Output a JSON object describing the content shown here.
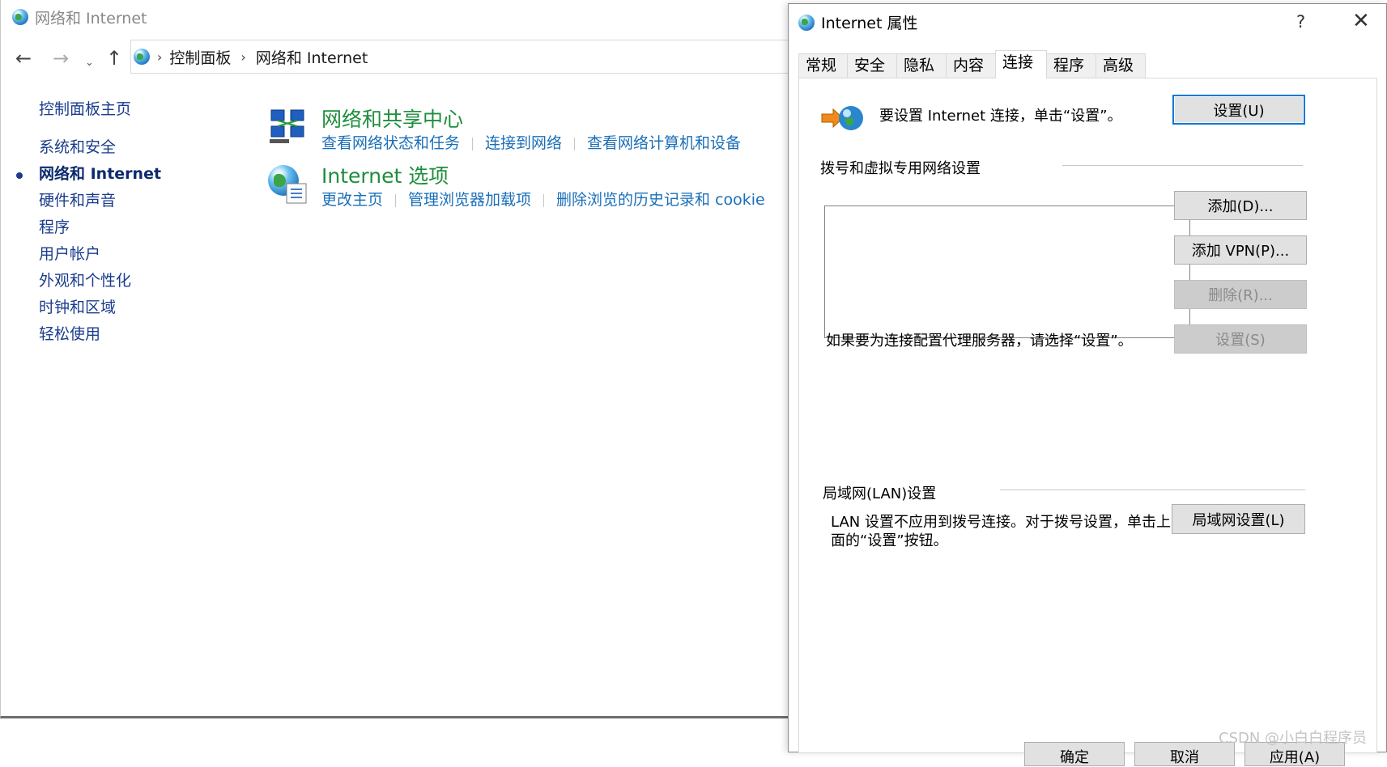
{
  "control_panel": {
    "window_title": "网络和 Internet",
    "address_crumbs": [
      "控制面板",
      "网络和 Internet"
    ],
    "sidebar": [
      {
        "label": "控制面板主页",
        "active": false
      },
      {
        "label": "系统和安全",
        "active": false
      },
      {
        "label": "网络和 Internet",
        "active": true
      },
      {
        "label": "硬件和声音",
        "active": false
      },
      {
        "label": "程序",
        "active": false
      },
      {
        "label": "用户帐户",
        "active": false
      },
      {
        "label": "外观和个性化",
        "active": false
      },
      {
        "label": "时钟和区域",
        "active": false
      },
      {
        "label": "轻松使用",
        "active": false
      }
    ],
    "categories": [
      {
        "title": "网络和共享中心",
        "links": [
          "查看网络状态和任务",
          "连接到网络",
          "查看网络计算机和设备"
        ]
      },
      {
        "title": "Internet 选项",
        "links": [
          "更改主页",
          "管理浏览器加载项",
          "删除浏览的历史记录和 cookie"
        ]
      }
    ]
  },
  "dialog": {
    "title": "Internet 属性",
    "help_icon": "?",
    "close_icon": "✕",
    "tabs": [
      "常规",
      "安全",
      "隐私",
      "内容",
      "连接",
      "程序",
      "高级"
    ],
    "active_tab": "连接",
    "setup_text": "要设置 Internet 连接，单击“设置”。",
    "setup_button": "设置(U)",
    "dialup_section": "拨号和虚拟专用网络设置",
    "add_button": "添加(D)...",
    "add_vpn_button": "添加 VPN(P)...",
    "remove_button": "删除(R)...",
    "proxy_text": "如果要为连接配置代理服务器，请选择“设置”。",
    "proxy_settings_button": "设置(S)",
    "lan_section": "局域网(LAN)设置",
    "lan_text_line1": "LAN 设置不应用到拨号连接。对于拨号设置，单击上",
    "lan_text_line2": "面的“设置”按钮。",
    "lan_button": "局域网设置(L)",
    "bottom_buttons": [
      "确定",
      "取消",
      "应用(A)"
    ]
  },
  "watermark": "CSDN @小白白程序员",
  "colors": {
    "link": "#1a6fb8",
    "category_title": "#1e8e3e",
    "sidebar_link": "#1a3c8b",
    "focus_border": "#0078d7"
  }
}
